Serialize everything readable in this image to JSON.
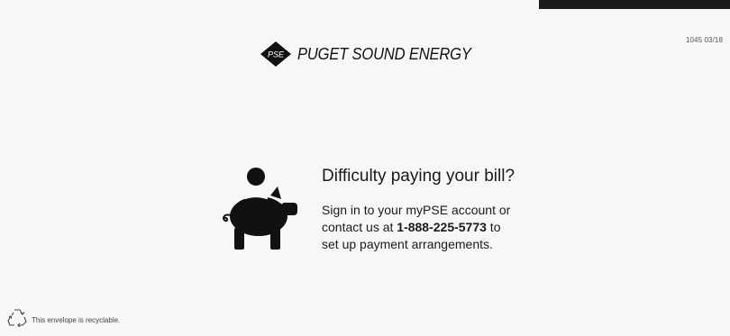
{
  "form_code": "1045 03/18",
  "brand": {
    "logo_text": "PSE",
    "name": "PUGET SOUND ENERGY"
  },
  "message": {
    "headline": "Difficulty paying your bill?",
    "line1": "Sign in to your myPSE account or",
    "line2_prefix": "contact us at ",
    "phone": "1-888-225-5773",
    "line2_suffix": " to",
    "line3": "set up payment arrangements."
  },
  "footer": {
    "recycle_note": "This envelope is recyclable."
  },
  "icons": {
    "logo": "pse-diamond-logo-icon",
    "illustration": "piggy-bank-icon",
    "recycle": "recycle-icon"
  },
  "colors": {
    "background": "#f7f7f7",
    "ink": "#141414",
    "top_bar": "#1a1a1a"
  }
}
